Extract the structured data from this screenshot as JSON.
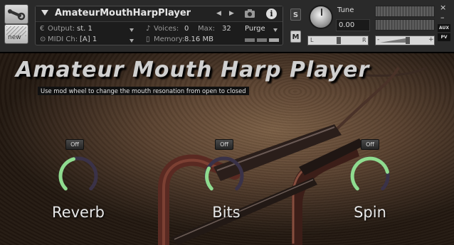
{
  "instrument": {
    "name": "AmateurMouthHarpPlayer",
    "output_label": "Output:",
    "output_value": "st. 1",
    "voices_label": "Voices:",
    "voices_value": "0",
    "max_label": "Max:",
    "max_value": "32",
    "purge_label": "Purge",
    "midi_label": "MIDI Ch:",
    "midi_value": "[A] 1",
    "memory_label": "Memory:",
    "memory_value": "8.16 MB"
  },
  "toolbar": {
    "new_label": "new",
    "solo_label": "S",
    "mute_label": "M",
    "tune_label": "Tune",
    "tune_value": "0.00",
    "pan_left": "L",
    "pan_right": "R",
    "vol_minus": "-",
    "vol_plus": "+",
    "aux_label": "AUX",
    "pv_label": "PV",
    "close_label": "×",
    "minimize_label": "–"
  },
  "main": {
    "title": "Amateur Mouth Harp Player",
    "hint": "Use mod wheel to change the mouth resonation from open to closed",
    "controls": [
      {
        "label": "Reverb",
        "toggle": "Off",
        "level": 0.45
      },
      {
        "label": "Bits",
        "toggle": "Off",
        "level": 0.35
      },
      {
        "label": "Spin",
        "toggle": "Off",
        "level": 0.6
      }
    ]
  },
  "colors": {
    "knob_active": "#8fdc8f",
    "knob_track": "#3a3248"
  }
}
